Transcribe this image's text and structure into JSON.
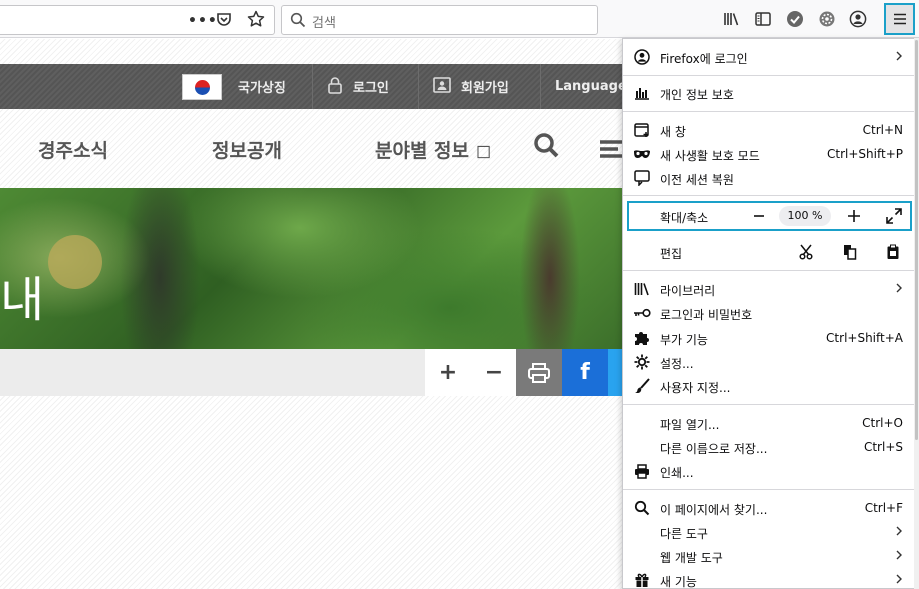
{
  "toolbar": {
    "url_more": "•••",
    "search_placeholder": "검색"
  },
  "site": {
    "top_links": [
      "국가상징",
      "로그인",
      "회원가입",
      "Language"
    ],
    "nav": [
      "경주소식",
      "정보공개",
      "분야별 정보 ◻"
    ],
    "hero_text": "내",
    "tools": [
      "+",
      "−",
      "f"
    ]
  },
  "menu": {
    "signin": "Firefox에 로그인",
    "privacy": "개인 정보 보호",
    "new_window": {
      "label": "새 창",
      "shortcut": "Ctrl+N"
    },
    "private_window": {
      "label": "새 사생활 보호 모드",
      "shortcut": "Ctrl+Shift+P"
    },
    "restore_session": "이전 세션 복원",
    "zoom": {
      "label": "확대/축소",
      "minus": "−",
      "value": "100 %",
      "plus": "+"
    },
    "edit": "편집",
    "library": "라이브러리",
    "logins": "로그인과 비밀번호",
    "addons": {
      "label": "부가 기능",
      "shortcut": "Ctrl+Shift+A"
    },
    "settings": "설정...",
    "customize": "사용자 지정...",
    "open_file": {
      "label": "파일 열기...",
      "shortcut": "Ctrl+O"
    },
    "save_as": {
      "label": "다른 이름으로 저장...",
      "shortcut": "Ctrl+S"
    },
    "print": "인쇄...",
    "find": {
      "label": "이 페이지에서 찾기...",
      "shortcut": "Ctrl+F"
    },
    "more_tools": "다른 도구",
    "web_dev": "웹 개발 도구",
    "whats_new": "새 기능"
  },
  "colors": {
    "focus_ring": "#1aa0c9",
    "site_header": "#555555",
    "facebook": "#1877f2"
  }
}
